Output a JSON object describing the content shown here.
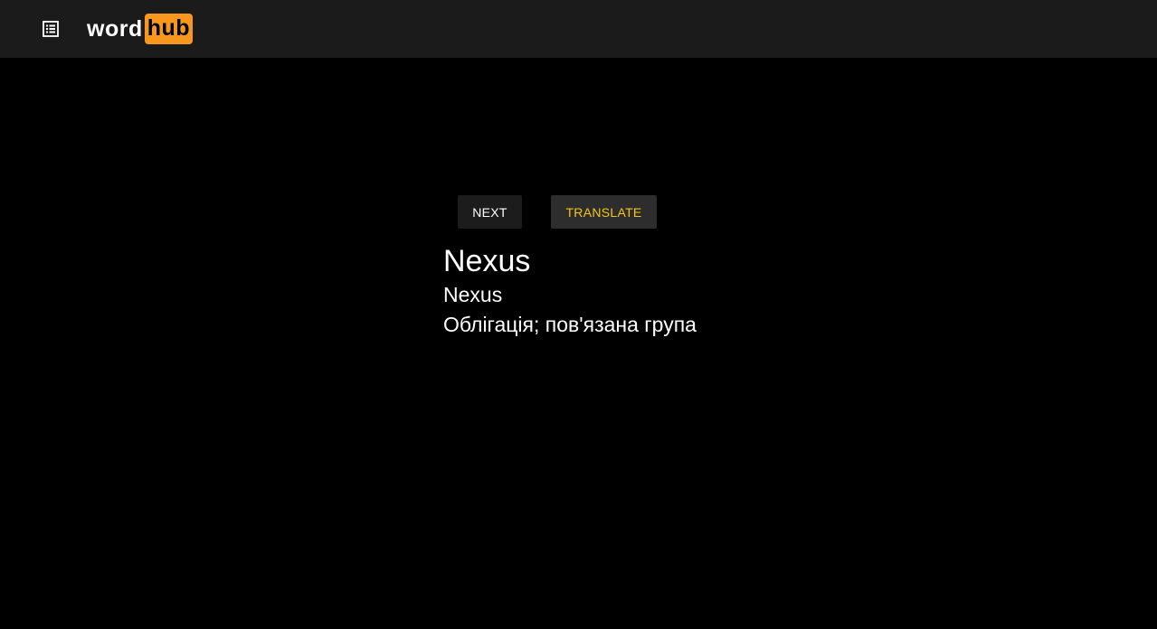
{
  "header": {
    "menu_icon": "list-menu-icon",
    "logo": {
      "word": "word",
      "hub": "hub",
      "hub_color": "#f7971d"
    }
  },
  "actions": {
    "next_label": "NEXT",
    "translate_label": "TRANSLATE",
    "translate_color": "#f5c518"
  },
  "card": {
    "word": "Nexus",
    "word_secondary": "Nexus",
    "translation": "Облігація; пов'язана група"
  }
}
